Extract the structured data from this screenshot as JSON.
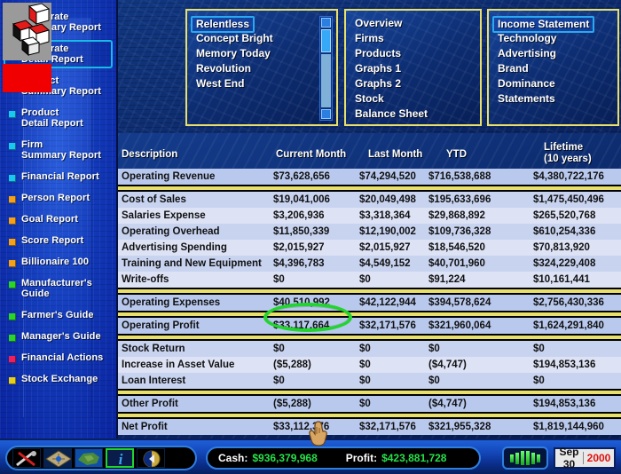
{
  "sidebar": {
    "items": [
      {
        "label": "Corporate\nSummary Report",
        "color": "#19c8f0",
        "selected": false
      },
      {
        "label": "Corporate\nDetail Report",
        "color": "#19c8f0",
        "selected": true
      },
      {
        "label": "Product\nSummary Report",
        "color": "#19c8f0",
        "selected": false
      },
      {
        "label": "Product\nDetail Report",
        "color": "#19c8f0",
        "selected": false
      },
      {
        "label": "Firm\nSummary Report",
        "color": "#19c8f0",
        "selected": false
      },
      {
        "label": "Financial Report",
        "color": "#19c8f0",
        "selected": false
      },
      {
        "label": "Person Report",
        "color": "#f5a11a",
        "selected": false
      },
      {
        "label": "Goal Report",
        "color": "#f5a11a",
        "selected": false
      },
      {
        "label": "Score Report",
        "color": "#f5a11a",
        "selected": false
      },
      {
        "label": "Billionaire 100",
        "color": "#f5a11a",
        "selected": false
      },
      {
        "label": "Manufacturer's\nGuide",
        "color": "#2ad42a",
        "selected": false
      },
      {
        "label": "Farmer's Guide",
        "color": "#2ad42a",
        "selected": false
      },
      {
        "label": "Manager's Guide",
        "color": "#2ad42a",
        "selected": false
      },
      {
        "label": "Financial Actions",
        "color": "#ee1f5e",
        "selected": false
      },
      {
        "label": "Stock Exchange",
        "color": "#e8d01a",
        "selected": false
      }
    ]
  },
  "logo": {
    "name": "company-logo-cubes"
  },
  "company_list": {
    "items": [
      {
        "label": "Relentless",
        "selected": true
      },
      {
        "label": "Concept Bright",
        "selected": false
      },
      {
        "label": "Memory Today",
        "selected": false
      },
      {
        "label": "Revolution",
        "selected": false
      },
      {
        "label": "West End",
        "selected": false
      }
    ]
  },
  "nav_primary": {
    "items": [
      {
        "label": "Overview",
        "selected": false
      },
      {
        "label": "Firms",
        "selected": false
      },
      {
        "label": "Products",
        "selected": false
      },
      {
        "label": "Graphs 1",
        "selected": false
      },
      {
        "label": "Graphs 2",
        "selected": false
      },
      {
        "label": "Stock",
        "selected": false
      },
      {
        "label": "Balance Sheet",
        "selected": false
      }
    ]
  },
  "nav_secondary": {
    "items": [
      {
        "label": "Income Statement",
        "selected": true
      },
      {
        "label": "Technology",
        "selected": false
      },
      {
        "label": "Advertising",
        "selected": false
      },
      {
        "label": "Brand",
        "selected": false
      },
      {
        "label": "Dominance",
        "selected": false
      },
      {
        "label": "Statements",
        "selected": false
      }
    ]
  },
  "table": {
    "headers": [
      "Description",
      "Current Month",
      "Last Month",
      "YTD",
      "Lifetime\n(10 years)"
    ],
    "rows": [
      {
        "type": "total",
        "cells": [
          "Operating Revenue",
          "$73,628,656",
          "$74,294,520",
          "$716,538,688",
          "$4,380,722,176"
        ]
      },
      {
        "type": "sep"
      },
      {
        "type": "item",
        "cells": [
          "Cost of Sales",
          "$19,041,006",
          "$20,049,498",
          "$195,633,696",
          "$1,475,450,496"
        ]
      },
      {
        "type": "item",
        "cells": [
          "Salaries Expense",
          "$3,206,936",
          "$3,318,364",
          "$29,868,892",
          "$265,520,768"
        ]
      },
      {
        "type": "item",
        "cells": [
          "Operating Overhead",
          "$11,850,339",
          "$12,190,002",
          "$109,736,328",
          "$610,254,336"
        ]
      },
      {
        "type": "item",
        "cells": [
          "Advertising Spending",
          "$2,015,927",
          "$2,015,927",
          "$18,546,520",
          "$70,813,920"
        ]
      },
      {
        "type": "item",
        "cells": [
          "Training and New Equipment",
          "$4,396,783",
          "$4,549,152",
          "$40,701,960",
          "$324,229,408"
        ]
      },
      {
        "type": "item",
        "cells": [
          "Write-offs",
          "$0",
          "$0",
          "$91,224",
          "$10,161,441"
        ]
      },
      {
        "type": "sep"
      },
      {
        "type": "total",
        "cells": [
          "Operating Expenses",
          "$40,510,992",
          "$42,122,944",
          "$394,578,624",
          "$2,756,430,336"
        ]
      },
      {
        "type": "sep"
      },
      {
        "type": "total",
        "cells": [
          "Operating Profit",
          "$33,117,664",
          "$32,171,576",
          "$321,960,064",
          "$1,624,291,840"
        ]
      },
      {
        "type": "sep"
      },
      {
        "type": "item",
        "cells": [
          "Stock Return",
          "$0",
          "$0",
          "$0",
          "$0"
        ]
      },
      {
        "type": "item",
        "cells": [
          "Increase in Asset Value",
          "($5,288)",
          "$0",
          "($4,747)",
          "$194,853,136"
        ]
      },
      {
        "type": "item",
        "cells": [
          "Loan Interest",
          "$0",
          "$0",
          "$0",
          "$0"
        ]
      },
      {
        "type": "sep"
      },
      {
        "type": "total",
        "cells": [
          "Other Profit",
          "($5,288)",
          "$0",
          "($4,747)",
          "$194,853,136"
        ]
      },
      {
        "type": "sep"
      },
      {
        "type": "total",
        "cells": [
          "Net Profit",
          "$33,112,376",
          "$32,171,576",
          "$321,955,328",
          "$1,819,144,960"
        ]
      }
    ],
    "highlight": {
      "target": "Operating Profit current month",
      "color": "#22d42e"
    }
  },
  "statusbar": {
    "tools": [
      {
        "name": "tools-icon",
        "selected": false
      },
      {
        "name": "city-grid-icon",
        "selected": false
      },
      {
        "name": "world-map-icon",
        "selected": false
      },
      {
        "name": "info-icon",
        "selected": true
      },
      {
        "name": "clock-dial-icon",
        "selected": false
      }
    ],
    "cash_label": "Cash:",
    "cash_value": "$936,379,968",
    "profit_label": "Profit:",
    "profit_value": "$423,881,728",
    "speed_bars": 6,
    "date_day": "Sep 30",
    "date_year": "2000",
    "accent_green": "#27e04a",
    "accent_yellow": "#e8e06a"
  }
}
